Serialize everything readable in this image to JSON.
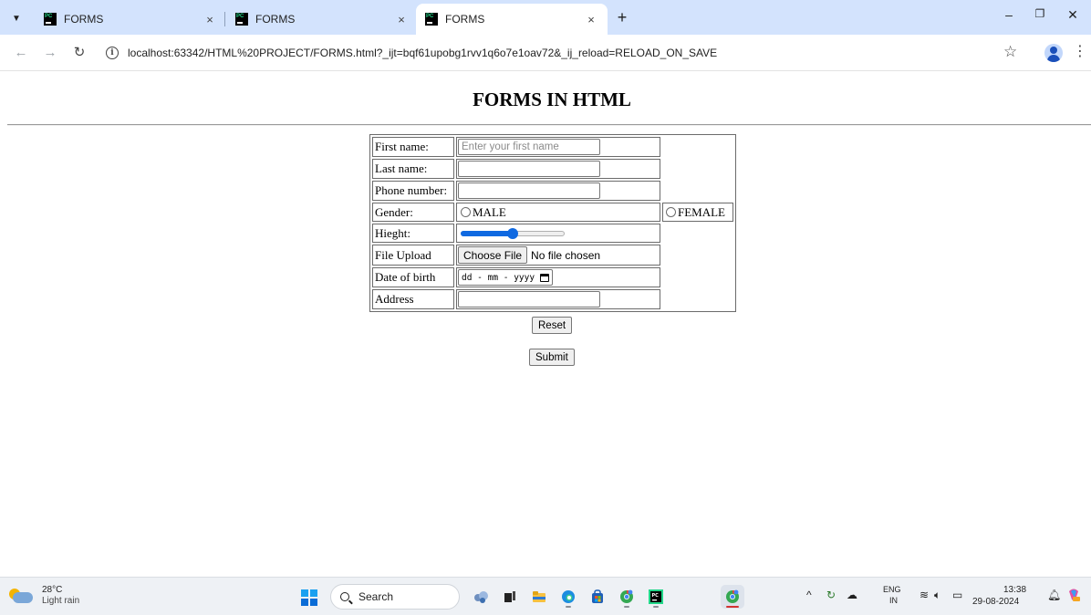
{
  "browser": {
    "tabs": [
      {
        "title": "FORMS",
        "close": "×",
        "active": false
      },
      {
        "title": "FORMS",
        "close": "×",
        "active": false
      },
      {
        "title": "FORMS",
        "close": "×",
        "active": true
      }
    ],
    "new_tab": "+",
    "url": "localhost:63342/HTML%20PROJECT/FORMS.html?_ijt=bqf61upobg1rvv1q6o7e1oav72&_ij_reload=RELOAD_ON_SAVE",
    "favicon_text": "PC"
  },
  "page": {
    "heading": "FORMS IN HTML",
    "form": {
      "first_name_label": "First name:",
      "first_name_placeholder": "Enter your first name",
      "last_name_label": "Last name:",
      "phone_label": "Phone number:",
      "gender_label": "Gender:",
      "male_label": "MALE",
      "female_label": "FEMALE",
      "height_label": "Hieght:",
      "height_value_fraction": 0.5,
      "file_label": "File Upload",
      "file_button": "Choose File",
      "file_status": "No file chosen",
      "dob_label": "Date of birth",
      "dob_placeholder": "dd - mm - yyyy",
      "address_label": "Address"
    },
    "reset_button": "Reset",
    "submit_button": "Submit"
  },
  "taskbar": {
    "weather_temp": "28°C",
    "weather_desc": "Light rain",
    "search_label": "Search",
    "lang_top": "ENG",
    "lang_bottom": "IN",
    "time": "13:38",
    "date": "29-08-2024"
  },
  "colors": {
    "tabstrip_bg": "#d3e3fd",
    "accent_blue": "#0f69e1",
    "taskbar_bg": "#eef1f5"
  }
}
